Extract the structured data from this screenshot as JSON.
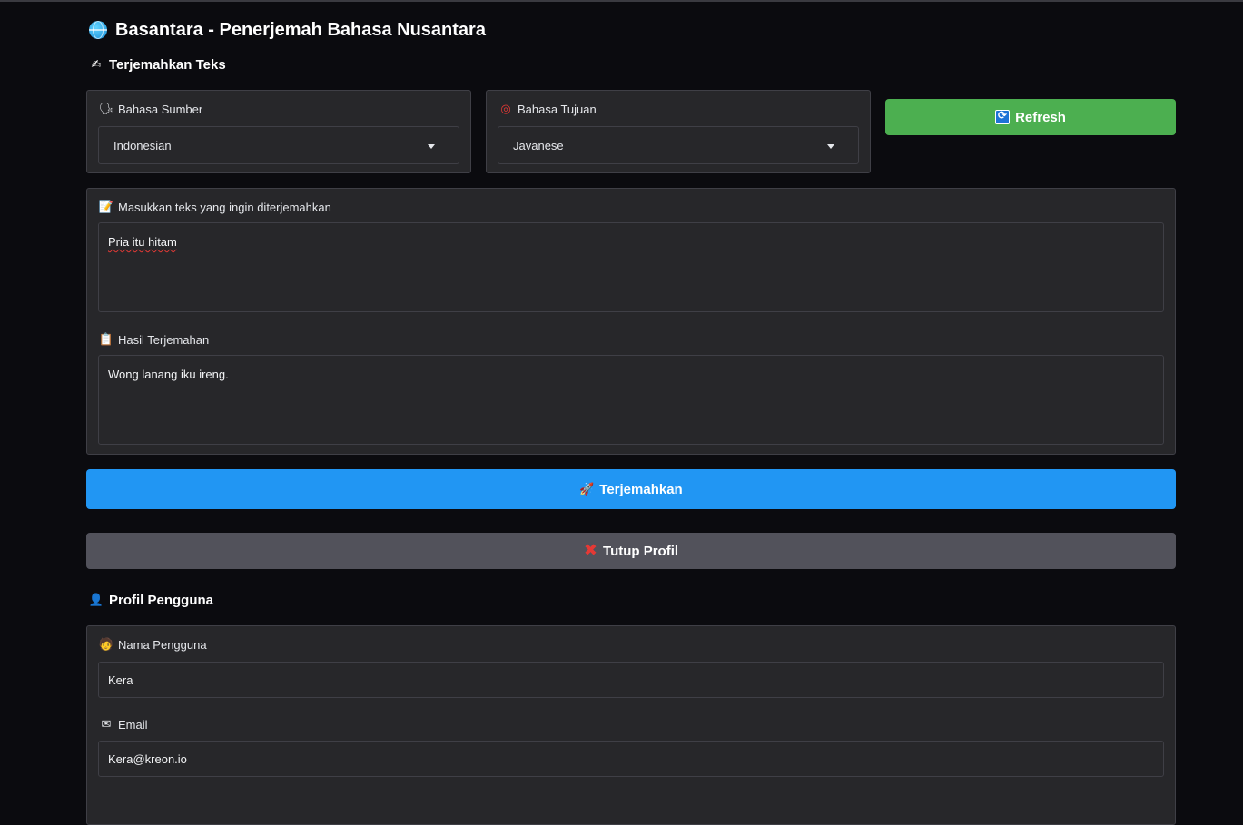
{
  "app": {
    "title": "Basantara - Penerjemah Bahasa Nusantara",
    "icon": "globe-icon"
  },
  "translate_section": {
    "title": "Terjemahkan Teks",
    "icon": "writing-hand-icon"
  },
  "source_language": {
    "label": "Bahasa Sumber",
    "icon": "person-speaking-icon",
    "value": "Indonesian"
  },
  "target_language": {
    "label": "Bahasa Tujuan",
    "icon": "target-icon",
    "value": "Javanese"
  },
  "refresh_button": {
    "label": "Refresh",
    "icon": "refresh-icon",
    "color": "#4caf50"
  },
  "input_text": {
    "label": "Masukkan teks yang ingin diterjemahkan",
    "icon": "memo-icon",
    "value": "Pria itu hitam"
  },
  "output_text": {
    "label": "Hasil Terjemahan",
    "icon": "clipboard-icon",
    "value": "Wong lanang iku ireng."
  },
  "translate_button": {
    "label": "Terjemahkan",
    "icon": "rocket-icon",
    "color": "#2196f3"
  },
  "close_profile_button": {
    "label": "Tutup Profil",
    "icon": "cross-mark-icon",
    "color": "#52525b"
  },
  "profile_section": {
    "title": "Profil Pengguna",
    "icon": "user-icon"
  },
  "profile": {
    "username": {
      "label": "Nama Pengguna",
      "icon": "person-icon",
      "value": "Kera"
    },
    "email": {
      "label": "Email",
      "icon": "envelope-icon",
      "value": "Kera@kreon.io"
    }
  }
}
